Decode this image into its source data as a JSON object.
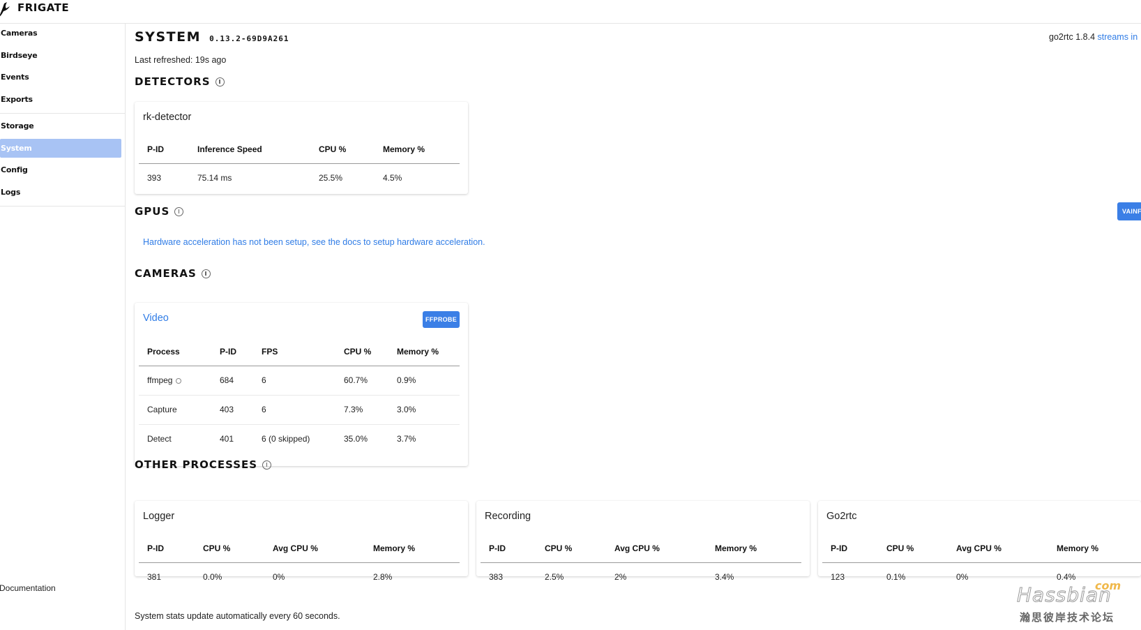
{
  "app": {
    "name": "FRIGATE"
  },
  "sidebar": {
    "items": [
      {
        "label": "Cameras"
      },
      {
        "label": "Birdseye"
      },
      {
        "label": "Events"
      },
      {
        "label": "Exports"
      },
      {
        "label": "Storage"
      },
      {
        "label": "System",
        "active": true
      },
      {
        "label": "Config"
      },
      {
        "label": "Logs"
      }
    ],
    "footer": {
      "documentation": "Documentation"
    }
  },
  "header": {
    "title": "SYSTEM",
    "version": "0.13.2-69D9A261",
    "last_refreshed": "Last refreshed: 19s ago",
    "go2rtc_text": "go2rtc 1.8.4",
    "go2rtc_link": "streams in"
  },
  "detectors": {
    "title": "DETECTORS",
    "card": {
      "name": "rk-detector",
      "columns": [
        "P-ID",
        "Inference Speed",
        "CPU %",
        "Memory %"
      ],
      "rows": [
        [
          "393",
          "75.14 ms",
          "25.5%",
          "4.5%"
        ]
      ]
    }
  },
  "gpus": {
    "title": "GPUS",
    "button": "VAINF",
    "message": "Hardware acceleration has not been setup, see the docs to setup hardware acceleration."
  },
  "cameras": {
    "title": "CAMERAS",
    "card": {
      "name": "Video",
      "button": "FFPROBE",
      "columns": [
        "Process",
        "P-ID",
        "FPS",
        "CPU %",
        "Memory %"
      ],
      "rows": [
        [
          "ffmpeg",
          "684",
          "6",
          "60.7%",
          "0.9%"
        ],
        [
          "Capture",
          "403",
          "6",
          "7.3%",
          "3.0%"
        ],
        [
          "Detect",
          "401",
          "6 (0 skipped)",
          "35.0%",
          "3.7%"
        ]
      ]
    }
  },
  "other_processes": {
    "title": "OTHER PROCESSES",
    "columns": [
      "P-ID",
      "CPU %",
      "Avg CPU %",
      "Memory %"
    ],
    "cards": [
      {
        "name": "Logger",
        "row": [
          "381",
          "0.0%",
          "0%",
          "2.8%"
        ]
      },
      {
        "name": "Recording",
        "row": [
          "383",
          "2.5%",
          "2%",
          "3.4%"
        ]
      },
      {
        "name": "Go2rtc",
        "row": [
          "123",
          "0.1%",
          "0%",
          "0.4%"
        ]
      }
    ]
  },
  "footer_note": "System stats update automatically every 60 seconds.",
  "watermark": {
    "main": "Hassbian",
    "com": "com",
    "sub": "瀚思彼岸技术论坛"
  },
  "colors": {
    "accent": "#3b7fe6",
    "link": "#2f7ce6",
    "active_nav": "#a8c3f4"
  }
}
